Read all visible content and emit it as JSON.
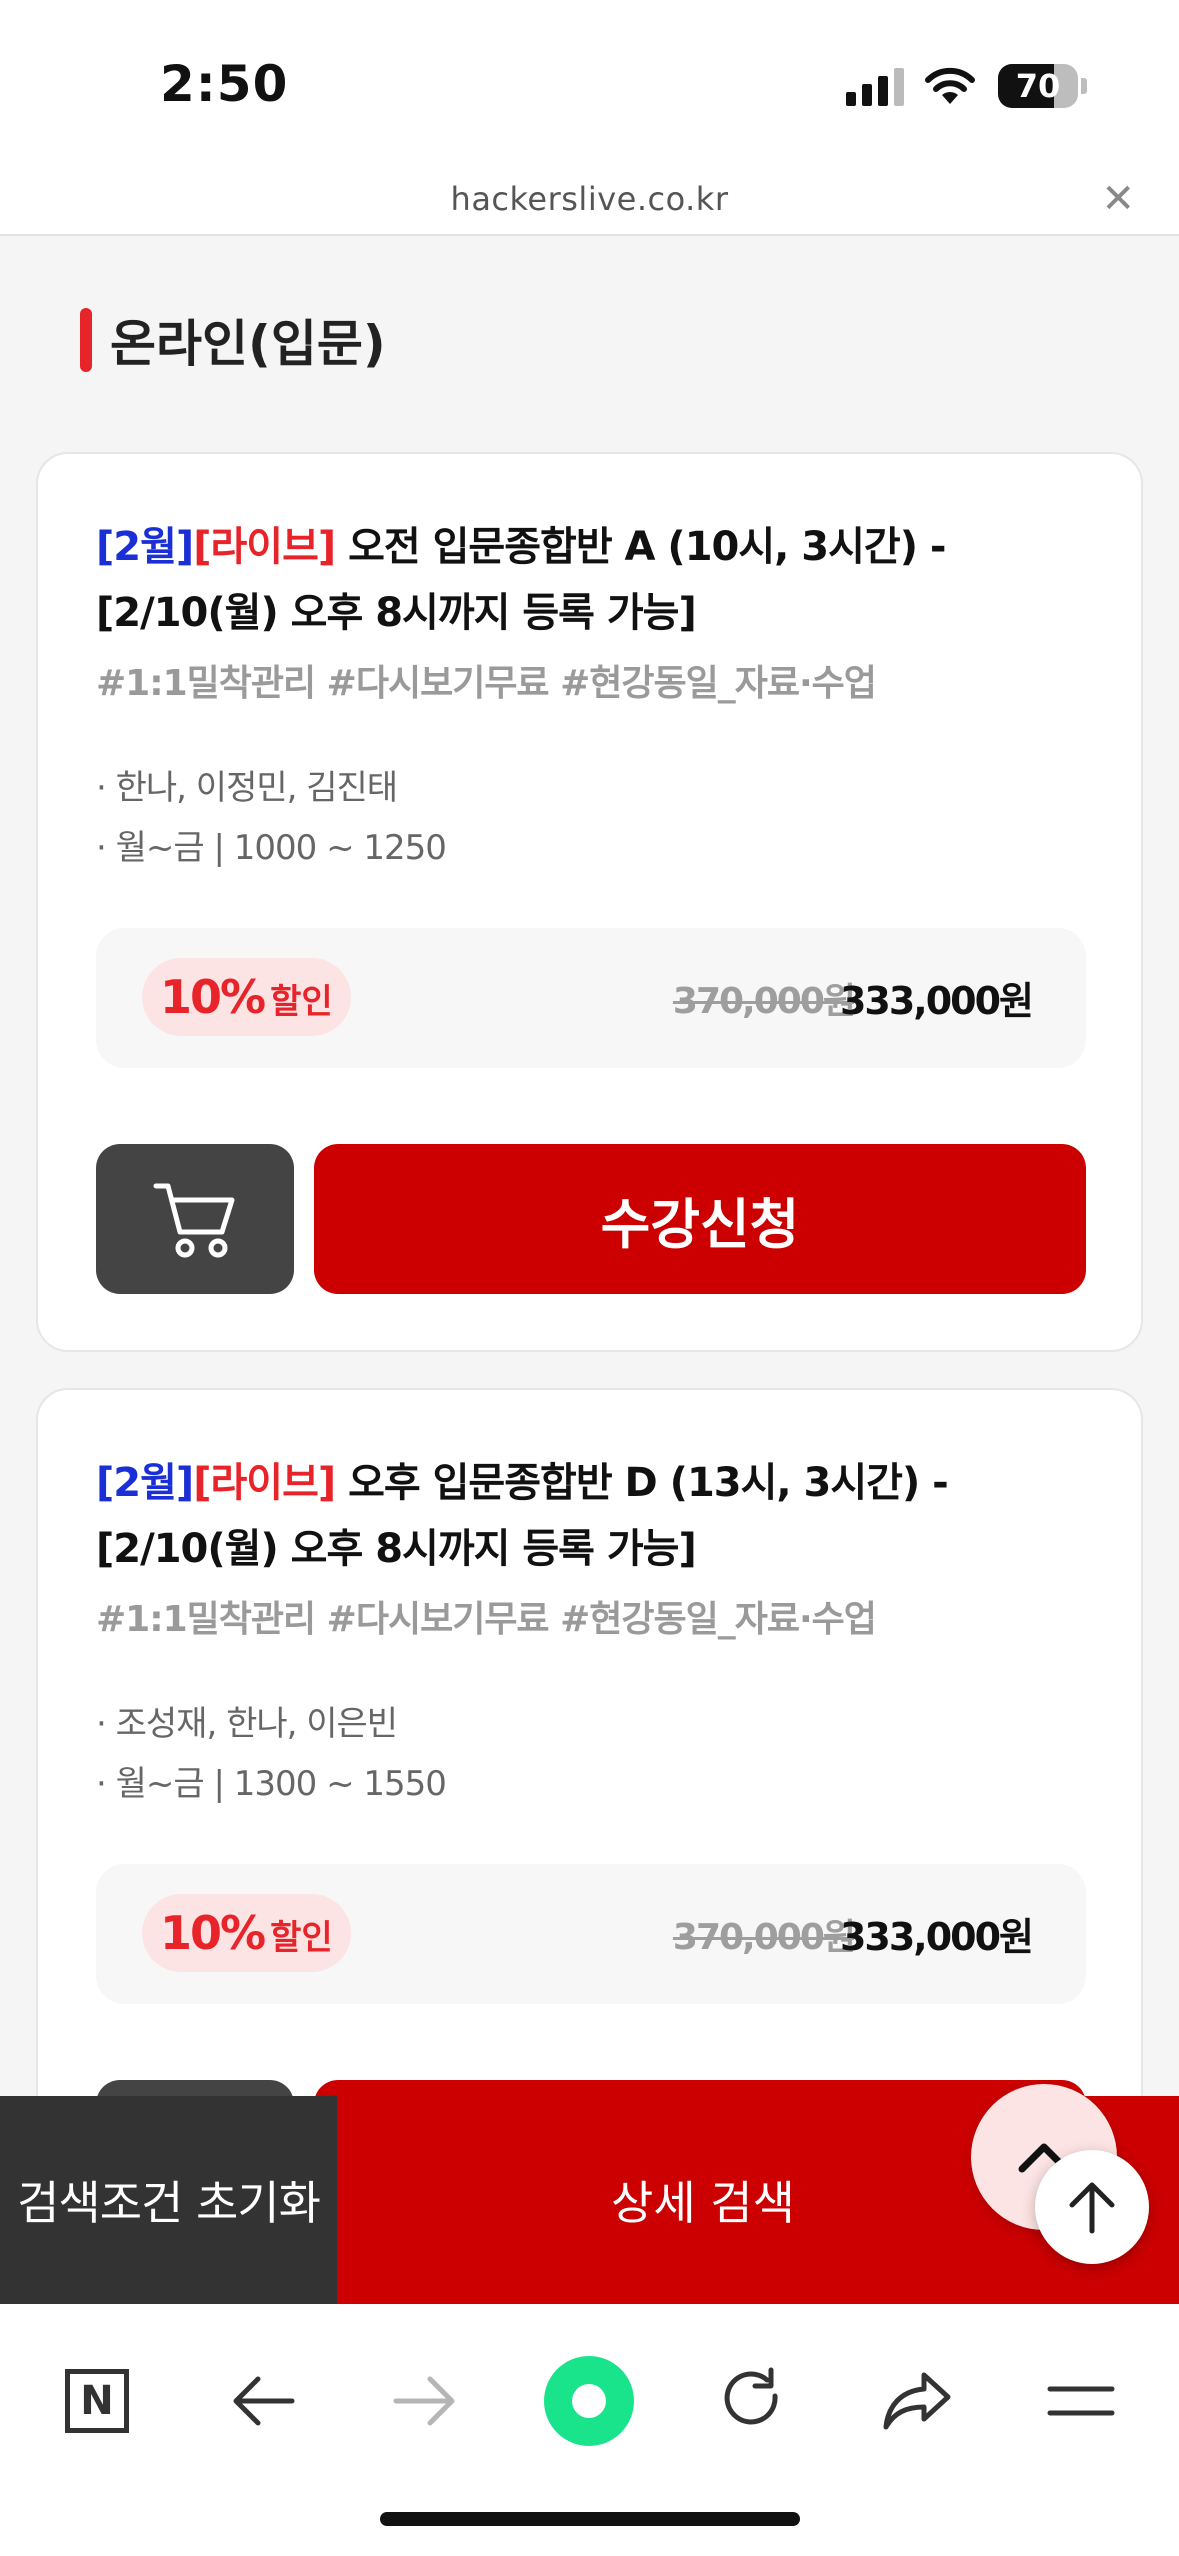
{
  "status_bar": {
    "time": "2:50",
    "battery": "70",
    "battery_level": 0.7
  },
  "browser": {
    "url": "hackerslive.co.kr",
    "close_icon": "close-icon"
  },
  "section": {
    "title": "온라인(입문)"
  },
  "courses": [
    {
      "tag_month": "[2월]",
      "tag_live": "[라이브]",
      "title": " 오전 입문종합반 A (10시, 3시간) - [2/10(월) 오후 8시까지 등록 가능]",
      "hashtags": "#1:1밀착관리 #다시보기무료 #현강동일_자료·수업",
      "teachers": "· 한나, 이정민, 김진태",
      "schedule": "· 월~금 | 1000 ~ 1250",
      "discount_pct": "10%",
      "discount_label": "할인",
      "original_price": "370,000원",
      "final_price": "333,000원",
      "apply_label": "수강신청"
    },
    {
      "tag_month": "[2월]",
      "tag_live": "[라이브]",
      "title": " 오후 입문종합반 D (13시, 3시간) - [2/10(월) 오후 8시까지 등록 가능]",
      "hashtags": "#1:1밀착관리 #다시보기무료 #현강동일_자료·수업",
      "teachers": "· 조성재, 한나, 이은빈",
      "schedule": "· 월~금 | 1300 ~ 1550",
      "discount_pct": "10%",
      "discount_label": "할인",
      "original_price": "370,000원",
      "final_price": "333,000원"
    }
  ],
  "bottom_bar": {
    "reset_label": "검색조건 초기화",
    "detail_search_label": "상세 검색"
  },
  "toolbar": {
    "n_label": "N"
  },
  "colors": {
    "accent_red": "#cc0000",
    "tag_red": "#e8242b",
    "tag_blue": "#1a2fd6",
    "naver_green": "#19e38b"
  }
}
